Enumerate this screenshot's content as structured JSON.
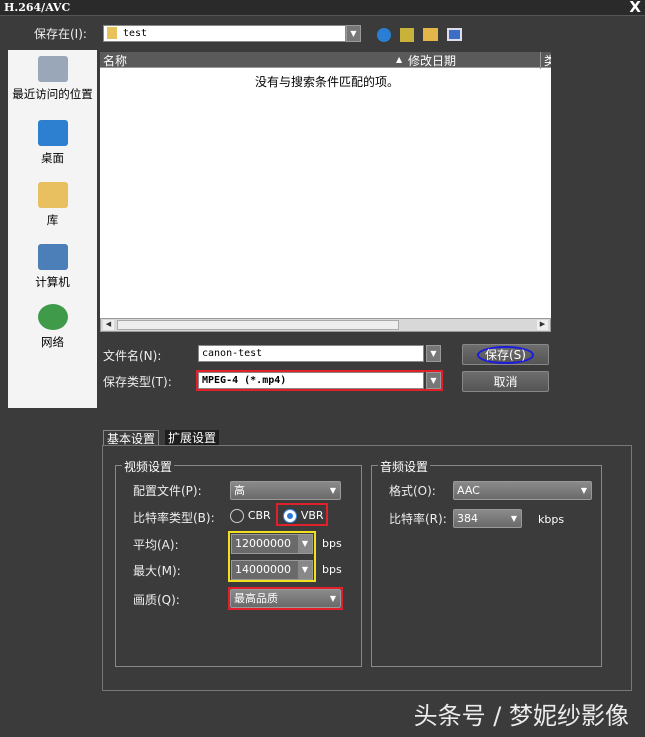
{
  "window": {
    "title": "H.264/AVC",
    "close": "X"
  },
  "save_in": {
    "label": "保存在(I):",
    "value": "test"
  },
  "sidebar": {
    "items": [
      {
        "label": "最近访问的位置"
      },
      {
        "label": "桌面"
      },
      {
        "label": "库"
      },
      {
        "label": "计算机"
      },
      {
        "label": "网络"
      }
    ]
  },
  "filelist": {
    "columns": [
      "名称",
      "修改日期",
      "类"
    ],
    "empty_message": "没有与搜索条件匹配的项。"
  },
  "filename": {
    "label": "文件名(N):",
    "value": "canon-test"
  },
  "filetype": {
    "label": "保存类型(T):",
    "value": "MPEG-4 (*.mp4)"
  },
  "buttons": {
    "save": "保存(S)",
    "cancel": "取消"
  },
  "tabs": [
    "基本设置",
    "扩展设置"
  ],
  "video": {
    "title": "视频设置",
    "profile_label": "配置文件(P):",
    "profile_value": "高",
    "bitrate_type_label": "比特率类型(B):",
    "cbr": "CBR",
    "vbr": "VBR",
    "avg_label": "平均(A):",
    "avg_value": "12000000",
    "max_label": "最大(M):",
    "max_value": "14000000",
    "unit": "bps",
    "quality_label": "画质(Q):",
    "quality_value": "最高品质"
  },
  "audio": {
    "title": "音频设置",
    "format_label": "格式(O):",
    "format_value": "AAC",
    "bitrate_label": "比特率(R):",
    "bitrate_value": "384",
    "unit": "kbps"
  },
  "watermark": "头条号 / 梦妮纱影像"
}
